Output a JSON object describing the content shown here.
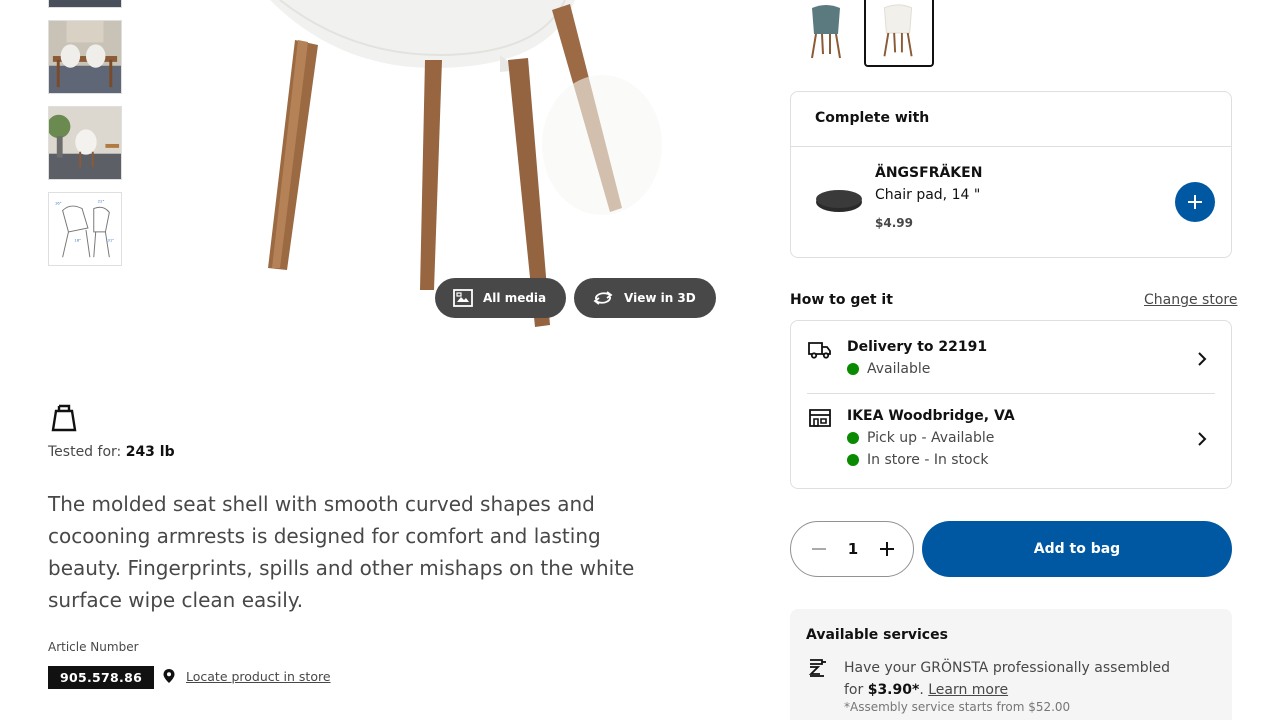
{
  "media": {
    "thumbnails": [
      "dining-room",
      "living-room",
      "dimensions-drawing"
    ],
    "all_media_label": "All media",
    "view_3d_label": "View in 3D"
  },
  "product": {
    "tested_label": "Tested for:",
    "tested_value": "243 lb",
    "description": "The molded seat shell with smooth curved shapes and cocooning armrests is designed for comfort and lasting beauty. Fingerprints, spills and other mishaps on the white surface wipe clean easily.",
    "article_label": "Article Number",
    "article_number": "905.578.86",
    "locate_label": "Locate product in store"
  },
  "swatches": [
    {
      "color": "#5b7a80",
      "selected": false
    },
    {
      "color": "#f2f0ea",
      "selected": true
    }
  ],
  "complete_with": {
    "title": "Complete with",
    "item": {
      "name": "ÄNGSFRÄKEN",
      "description": "Chair pad, 14 \"",
      "price": "$4.99"
    }
  },
  "how_to_get": {
    "title": "How to get it",
    "change_store": "Change store",
    "delivery": {
      "title": "Delivery to 22191",
      "status": "Available"
    },
    "store": {
      "title": "IKEA Woodbridge, VA",
      "pickup_status": "Pick up - Available",
      "instore_status": "In store - In stock"
    }
  },
  "purchase": {
    "quantity": "1",
    "add_to_bag": "Add to bag"
  },
  "services": {
    "title": "Available services",
    "text_prefix": "Have your GRÖNSTA professionally assembled for",
    "price": "$3.90*",
    "learn_more": "Learn more",
    "note": "*Assembly service starts from $52.00"
  },
  "colors": {
    "ikea_blue": "#0058a3",
    "available_green": "#0a8a00",
    "pill_dark": "#484848"
  },
  "icons": [
    "weight-icon",
    "gallery-icon",
    "rotate-3d-icon",
    "pin-icon",
    "truck-icon",
    "store-icon",
    "chevron-right-icon",
    "plus-icon",
    "minus-icon",
    "assembly-icon"
  ]
}
